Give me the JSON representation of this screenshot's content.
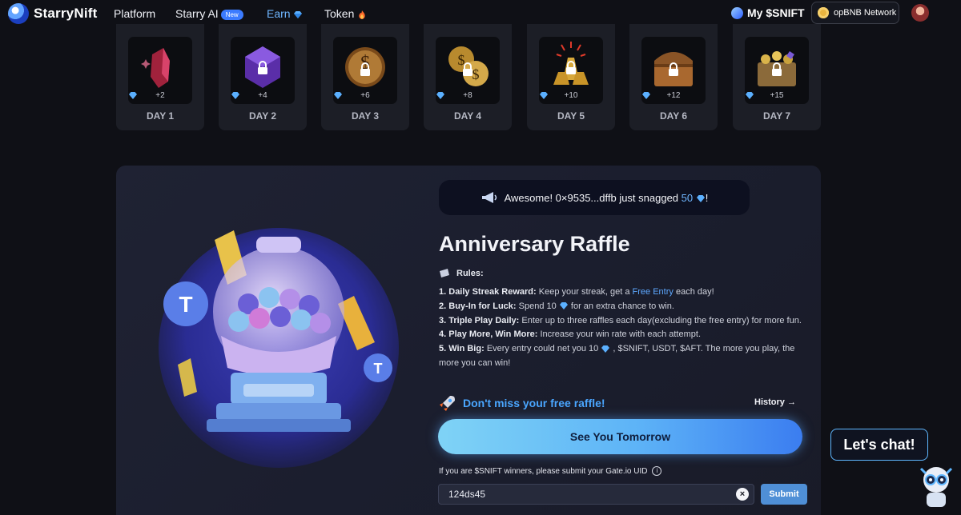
{
  "nav": {
    "brand": "StarryNift",
    "links": [
      "Platform",
      "Starry AI",
      "Earn",
      "Token"
    ],
    "new_badge": "New",
    "my_token": "My $SNIFT",
    "network": "opBNB Network"
  },
  "days": [
    {
      "label": "DAY 1",
      "reward": "+2",
      "icon": "red-crystal-icon"
    },
    {
      "label": "DAY 2",
      "reward": "+4",
      "icon": "purple-gem-icon"
    },
    {
      "label": "DAY 3",
      "reward": "+6",
      "icon": "coin-icon"
    },
    {
      "label": "DAY 4",
      "reward": "+8",
      "icon": "coins-icon"
    },
    {
      "label": "DAY 5",
      "reward": "+10",
      "icon": "gold-bars-icon"
    },
    {
      "label": "DAY 6",
      "reward": "+12",
      "icon": "treasure-chest-icon"
    },
    {
      "label": "DAY 7",
      "reward": "+15",
      "icon": "treasure-box-icon"
    }
  ],
  "raffle": {
    "notice_prefix": "Awesome! 0×9535...dffb just snagged",
    "notice_amount": "50",
    "notice_suffix": "!",
    "title": "Anniversary Raffle",
    "rules_heading": "Rules:",
    "rules": [
      {
        "num": "1.",
        "bold": "Daily Streak Reward:",
        "pre": "Keep your streak, get a",
        "hl": "Free Entry",
        "post": "each day!"
      },
      {
        "num": "2.",
        "bold": "Buy-In for Luck:",
        "pre": "Spend 10",
        "post": "for an extra chance to win."
      },
      {
        "num": "3.",
        "bold": "Triple Play Daily:",
        "text": "Enter up to three raffles each day(excluding the free entry) for more fun."
      },
      {
        "num": "4.",
        "bold": "Play More, Win More:",
        "text": "Increase your win rate with each attempt."
      },
      {
        "num": "5.",
        "bold": "Win Big:",
        "pre": "Every entry could net you 10",
        "post": ", $SNIFT, USDT, $AFT. The more you play, the more you can win!"
      }
    ],
    "free_raffle": "Don't miss your free raffle!",
    "history": "History →",
    "cta": "See You Tomorrow",
    "uid_note": "If you are $SNIFT winners, please submit your Gate.io UID",
    "uid_value": "124ds45",
    "submit": "Submit"
  },
  "chat": {
    "label": "Let's chat!"
  },
  "colors": {
    "accent": "#6fb6ff",
    "panel": "#1f2233",
    "cta_start": "#7fd3f6",
    "cta_end": "#3b7df0"
  }
}
